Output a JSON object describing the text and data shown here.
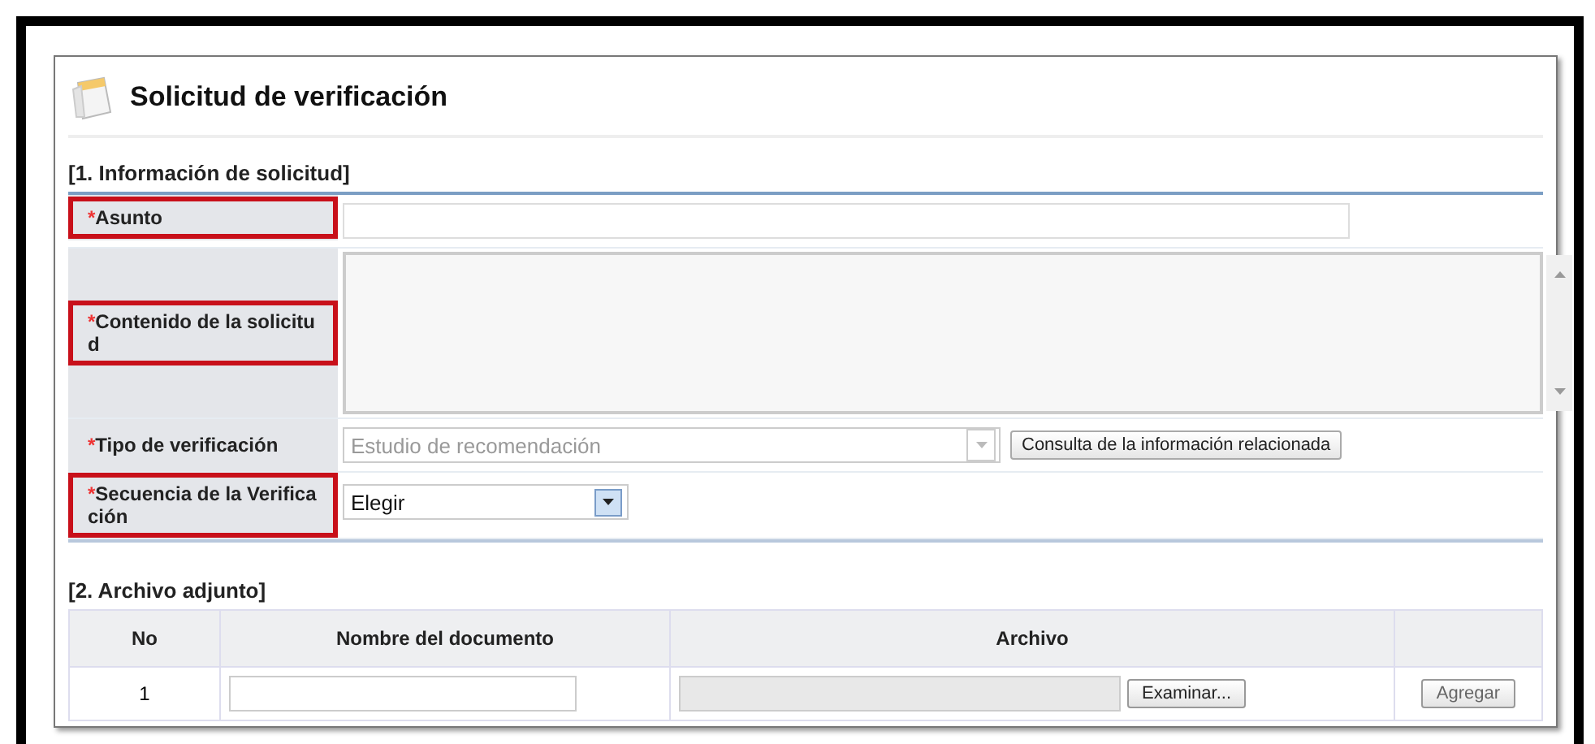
{
  "title": "Solicitud de verificación",
  "section1": {
    "heading": "[1. Información de solicitud]",
    "fields": [
      {
        "kind": "text",
        "label": "Asunto",
        "mark": "*",
        "highlighted": true
      },
      {
        "kind": "textarea",
        "label": "Contenido de la solicitud",
        "mark": "*",
        "highlighted": true
      },
      {
        "kind": "disabled-select",
        "label": "Tipo de verificación",
        "mark": "*",
        "highlighted": false,
        "value": "Estudio de recomendación",
        "button": "Consulta de la información relacionada"
      },
      {
        "kind": "select",
        "label": "Secuencia de la Verificación",
        "mark": "*",
        "highlighted": true,
        "value": "Elegir"
      }
    ]
  },
  "section2": {
    "heading": "[2. Archivo adjunto]",
    "columns": [
      "No",
      "Nombre del documento",
      "Archivo"
    ],
    "rows": [
      {
        "no": "1",
        "browse_button": "Examinar...",
        "add_button": "Agregar"
      }
    ]
  }
}
